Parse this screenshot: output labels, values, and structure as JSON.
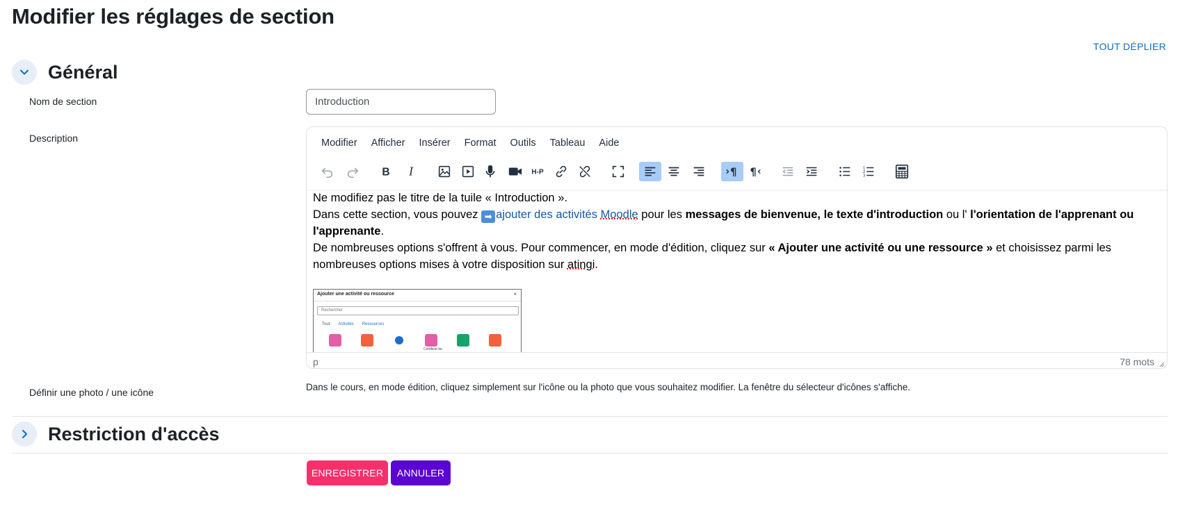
{
  "page": {
    "title": "Modifier les réglages de section",
    "expand_all": "TOUT DÉPLIER"
  },
  "general": {
    "title": "Général",
    "toggle_icon": "chevron-down-icon",
    "section_name_label": "Nom de section",
    "section_name_value": "Introduction",
    "description_label": "Description"
  },
  "editor": {
    "menu": [
      "Modifier",
      "Afficher",
      "Insérer",
      "Format",
      "Outils",
      "Tableau",
      "Aide"
    ],
    "toolbar": [
      {
        "name": "undo-icon"
      },
      {
        "name": "redo-icon"
      },
      {
        "name": "bold-icon"
      },
      {
        "name": "italic-icon"
      },
      {
        "name": "image-icon"
      },
      {
        "name": "media-icon"
      },
      {
        "name": "microphone-icon"
      },
      {
        "name": "video-icon"
      },
      {
        "name": "h5p-icon"
      },
      {
        "name": "link-icon"
      },
      {
        "name": "unlink-icon"
      },
      {
        "name": "fullscreen-icon"
      },
      {
        "name": "align-left-icon",
        "active": true
      },
      {
        "name": "align-center-icon"
      },
      {
        "name": "align-right-icon"
      },
      {
        "name": "ltr-icon",
        "active": true
      },
      {
        "name": "rtl-icon"
      },
      {
        "name": "outdent-icon"
      },
      {
        "name": "indent-icon"
      },
      {
        "name": "bullet-list-icon"
      },
      {
        "name": "numbered-list-icon"
      },
      {
        "name": "calculator-icon"
      }
    ],
    "content": {
      "line1": "Ne modifiez pas le titre de la tuile « Introduction ».",
      "p2_a": "Dans cette section, vous pouvez ",
      "p2_arrow": "➡",
      "p2_link_a": "ajouter des activités ",
      "p2_link_b": "Moodle",
      "p2_b": " pour les ",
      "p2_bold1": "messages de bienvenue, le texte d'introduction",
      "p2_c": " ou l' ",
      "p2_bold2": "l'orientation de l'apprenant ou l'apprenante",
      "p2_d": ".",
      "p3_a": "De nombreuses options s'offrent à vous. Pour commencer, en mode d'édition, cliquez sur ",
      "p3_bold": "« Ajouter une activité ou une ressource »",
      "p3_b": " et choisissez parmi les nombreuses options mises à votre disposition sur ",
      "p3_word": "atingi",
      "p3_c": "."
    },
    "thumbnail": {
      "title": "Ajouter une activité ou ressource",
      "close": "×",
      "search_placeholder": "Rechercher",
      "tabs": [
        "Tout",
        "Activités",
        "Ressources"
      ],
      "tile_colors": [
        "#e05fa6",
        "#f0623e",
        "#1c6dcf",
        "#e05fa6",
        "#16a36a",
        "#f0623e"
      ],
      "caption": "Certificat du"
    },
    "status_path": "p",
    "word_count": "78 mots"
  },
  "photo": {
    "label": "Définir une photo / une icône",
    "help": "Dans le cours, en mode édition, cliquez simplement sur l'icône ou la photo que vous souhaitez modifier. La fenêtre du sélecteur d'icônes s'affiche."
  },
  "restriction": {
    "title": "Restriction d'accès",
    "toggle_icon": "chevron-right-icon"
  },
  "buttons": {
    "save": "ENREGISTRER",
    "cancel": "ANNULER"
  },
  "colors": {
    "link": "#0f6cbf",
    "save": "#f7306c",
    "cancel": "#5b04d3",
    "active_tool": "#a6ccf7"
  }
}
